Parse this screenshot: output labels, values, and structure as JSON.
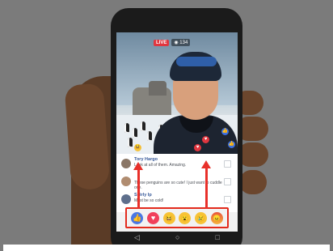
{
  "video": {
    "live_label": "LIVE",
    "viewers": "134"
  },
  "comments": [
    {
      "name": "Tory Hargo",
      "text": "Look at all of them. Amazing."
    },
    {
      "name": "",
      "text": "These penguins are so cute! I just want to cuddle one."
    },
    {
      "name": "Shirly Ip",
      "text": "Must be so cold!"
    }
  ],
  "reactions": [
    {
      "name": "like",
      "glyph": "👍"
    },
    {
      "name": "love",
      "glyph": "♥"
    },
    {
      "name": "haha",
      "glyph": "😆"
    },
    {
      "name": "wow",
      "glyph": "😮"
    },
    {
      "name": "sad",
      "glyph": "😢"
    },
    {
      "name": "angry",
      "glyph": "😠"
    }
  ],
  "navbar": {
    "back": "◁",
    "home": "○",
    "recents": "□"
  },
  "colors": {
    "highlight": "#e32b1d",
    "live": "#e0363f",
    "like": "#4a77e3",
    "love": "#f1405b"
  }
}
